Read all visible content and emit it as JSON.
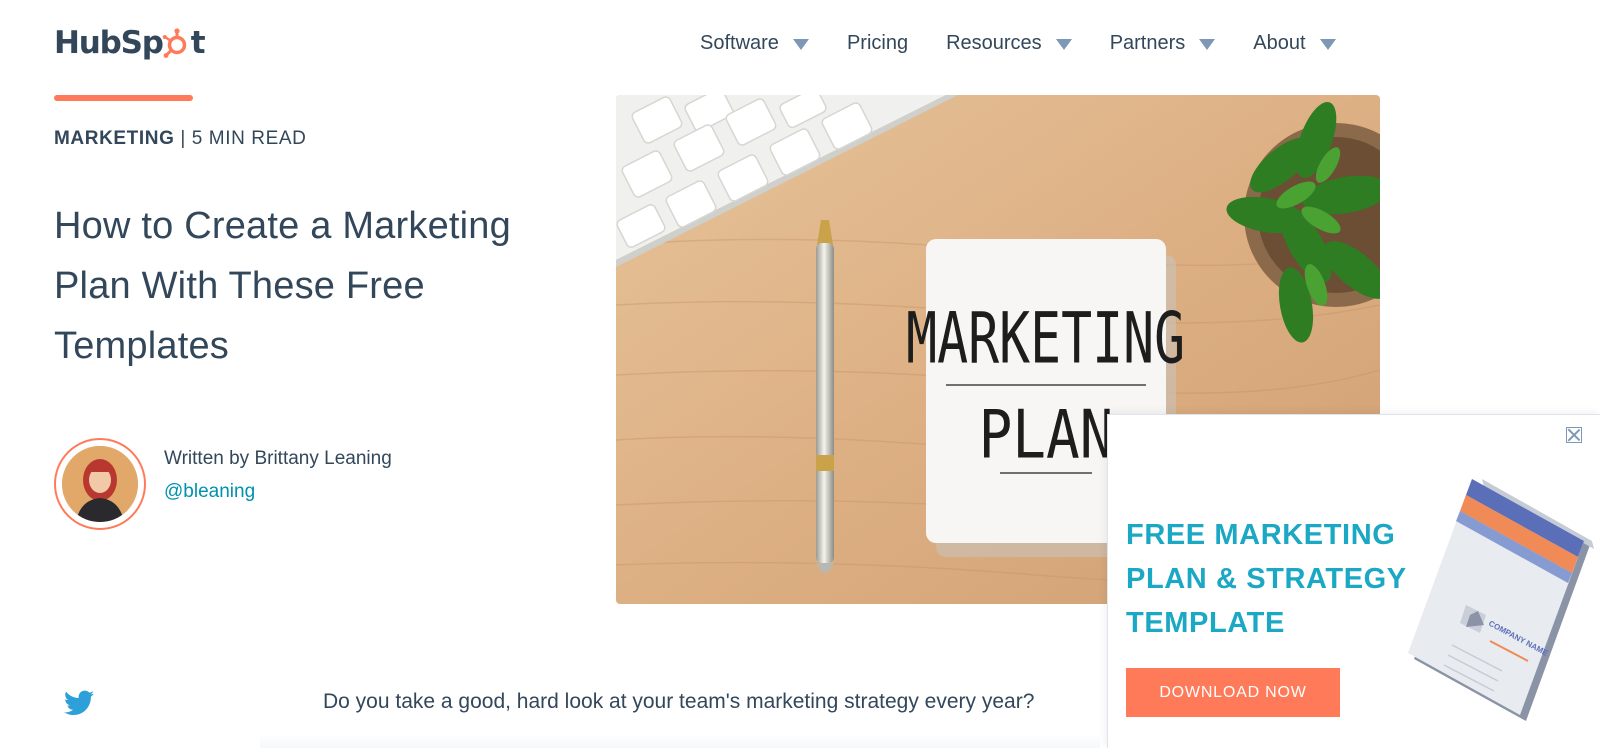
{
  "brand": {
    "logo_text_pre": "HubSp",
    "logo_text_post": "t",
    "accent_color": "#ff7a59",
    "text_color": "#33475b",
    "link_color": "#0091ae",
    "cta_color": "#1ba8c4"
  },
  "nav": {
    "items": [
      {
        "label": "Software",
        "has_dropdown": true
      },
      {
        "label": "Pricing",
        "has_dropdown": false
      },
      {
        "label": "Resources",
        "has_dropdown": true
      },
      {
        "label": "Partners",
        "has_dropdown": true
      },
      {
        "label": "About",
        "has_dropdown": true
      }
    ]
  },
  "article": {
    "category": "MARKETING",
    "separator": " | ",
    "read_time": "5 MIN READ",
    "title": "How to Create a Marketing Plan With These Free Templates",
    "author_line": "Written by Brittany Leaning",
    "author_handle": "@bleaning",
    "hero_text_line1": "MARKETING",
    "hero_text_line2": "PLAN",
    "lead": "Do you take a good, hard look at your team's marketing strategy every year?"
  },
  "cta": {
    "heading": "FREE MARKETING PLAN & STRATEGY TEMPLATE",
    "button_label": "DOWNLOAD NOW",
    "book_text": "COMPANY NAME"
  },
  "icons": {
    "twitter": "twitter-icon",
    "close": "close-icon",
    "dropdown": "caret-down-icon"
  }
}
